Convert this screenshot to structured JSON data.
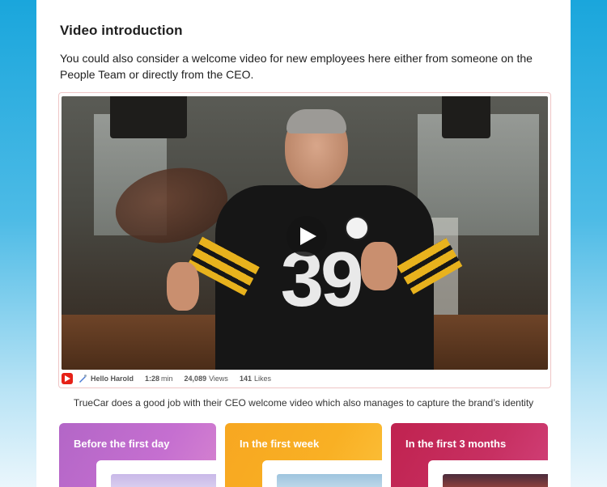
{
  "section": {
    "title": "Video introduction",
    "intro": "You could also consider a welcome video for new employees here either from someone on the People Team or directly from the CEO."
  },
  "video": {
    "jersey_number": "39",
    "source_icon": "youtube-icon",
    "author": "Hello Harold",
    "duration": "1:28",
    "duration_unit": "min",
    "views": "24,089",
    "views_label": "Views",
    "likes": "141",
    "likes_label": "Likes",
    "caption": "TrueCar does a good job with their CEO welcome video which also manages to capture the brand’s identity"
  },
  "stages": [
    {
      "label": "Before the first day",
      "color": "#b366c7"
    },
    {
      "label": "In the first week",
      "color": "#f7a721"
    },
    {
      "label": "In the first 3 months",
      "color": "#c0224f"
    }
  ]
}
